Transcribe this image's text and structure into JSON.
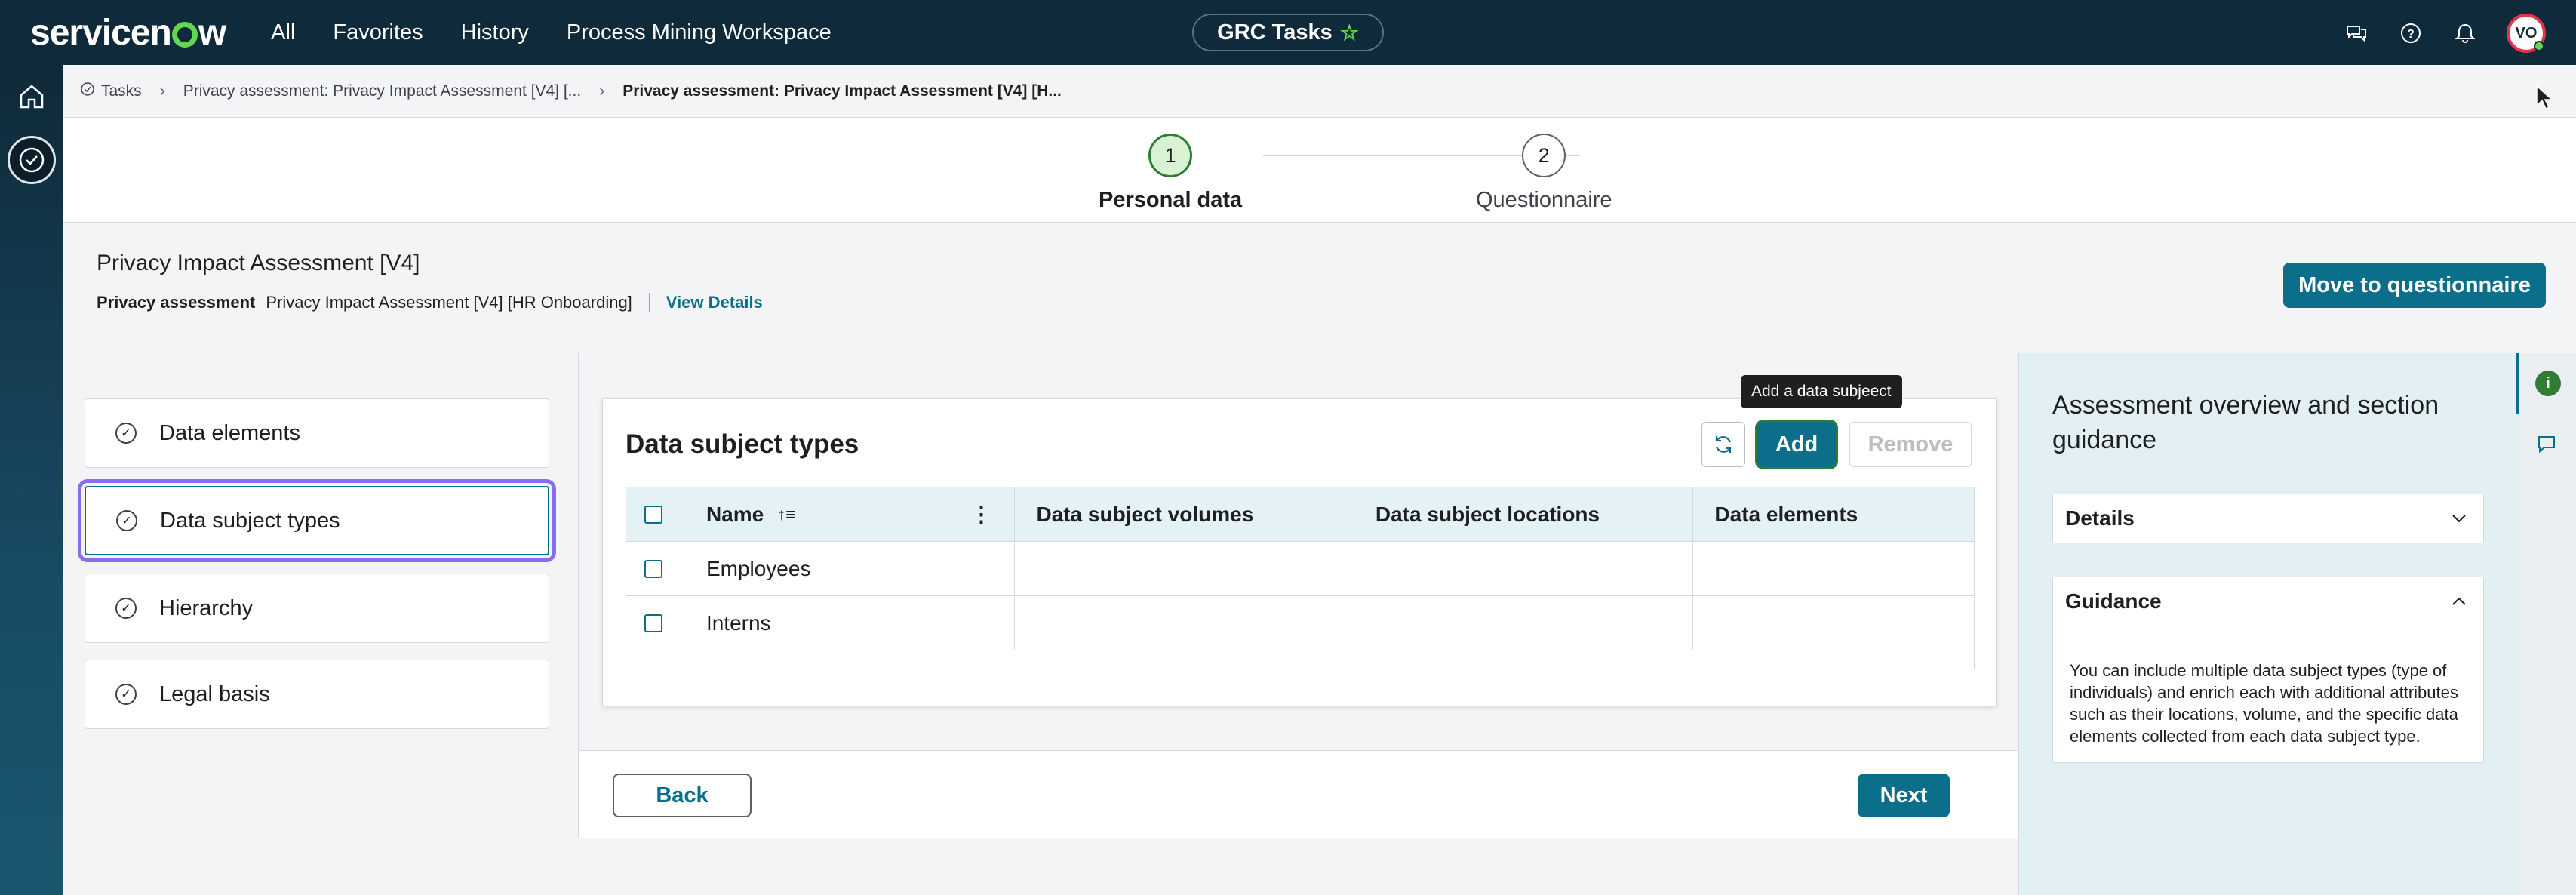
{
  "brand": {
    "name_pre": "servicen",
    "name_post": "w"
  },
  "nav": {
    "items": [
      "All",
      "Favorites",
      "History",
      "Process Mining Workspace"
    ]
  },
  "grc": {
    "label": "GRC Tasks"
  },
  "user": {
    "initials": "VO"
  },
  "breadcrumb": {
    "items": [
      "Tasks",
      "Privacy assessment: Privacy Impact Assessment [V4] [...",
      "Privacy assessment: Privacy Impact Assessment [V4] [H..."
    ]
  },
  "stepper": {
    "steps": [
      {
        "num": "1",
        "label": "Personal data"
      },
      {
        "num": "2",
        "label": "Questionnaire"
      }
    ]
  },
  "header": {
    "title": "Privacy Impact Assessment [V4]",
    "meta_key": "Privacy assessment",
    "meta_value": "Privacy Impact Assessment [V4] [HR Onboarding]",
    "view_details": "View Details",
    "move_button": "Move to questionnaire"
  },
  "sections": {
    "items": [
      "Data elements",
      "Data subject types",
      "Hierarchy",
      "Legal basis"
    ]
  },
  "card": {
    "title": "Data subject types",
    "tooltip": "Add a data subjeect",
    "add": "Add",
    "remove": "Remove",
    "columns": [
      "Name",
      "Data subject volumes",
      "Data subject locations",
      "Data elements"
    ],
    "rows": [
      {
        "name": "Employees"
      },
      {
        "name": "Interns"
      }
    ]
  },
  "footer": {
    "back": "Back",
    "next": "Next"
  },
  "guidance": {
    "title": "Assessment overview and section guidance",
    "details_label": "Details",
    "guidance_label": "Guidance",
    "guidance_text": "You can include multiple data subject types (type of individuals) and enrich each with additional attributes such as their locations, volume, and the specific data elements collected from each data subject type."
  }
}
